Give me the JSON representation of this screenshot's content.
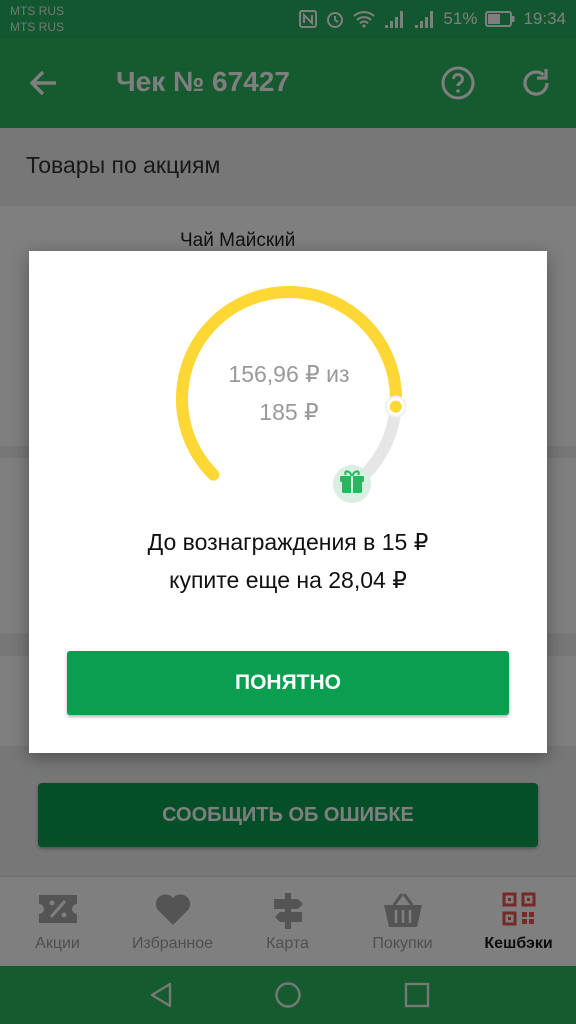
{
  "status_bar": {
    "carrier1": "MTS RUS",
    "carrier2": "MTS RUS",
    "battery": "51%",
    "time": "19:34"
  },
  "app_bar": {
    "title": "Чек № 67427",
    "back_icon": "arrow-left-icon",
    "help_icon": "question-circle-icon",
    "refresh_icon": "refresh-icon"
  },
  "page": {
    "section_title": "Товары по акциям",
    "product_name": "Чай Майский",
    "report_button": "СООБЩИТЬ ОБ ОШИБКЕ"
  },
  "dialog": {
    "progress_text_line1": "156,96 ₽ из",
    "progress_text_line2": "185 ₽",
    "progress_value": 156.96,
    "progress_target": 185,
    "message_line1": "До вознаграждения в 15 ₽",
    "message_line2": "купите еще на 28,04 ₽",
    "ok_button": "ПОНЯТНО",
    "gift_icon": "gift-icon"
  },
  "bottom_nav": {
    "items": [
      {
        "label": "Акции",
        "icon": "discount-ticket-icon",
        "active": false
      },
      {
        "label": "Избранное",
        "icon": "heart-icon",
        "active": false
      },
      {
        "label": "Карта",
        "icon": "signpost-icon",
        "active": false
      },
      {
        "label": "Покупки",
        "icon": "basket-icon",
        "active": false
      },
      {
        "label": "Кешбэки",
        "icon": "qr-code-icon",
        "active": true
      }
    ]
  },
  "colors": {
    "primary_green": "#2cb45f",
    "button_green": "#0a9e50",
    "gauge_yellow": "#fdd835",
    "accent_red": "#ef5350"
  }
}
